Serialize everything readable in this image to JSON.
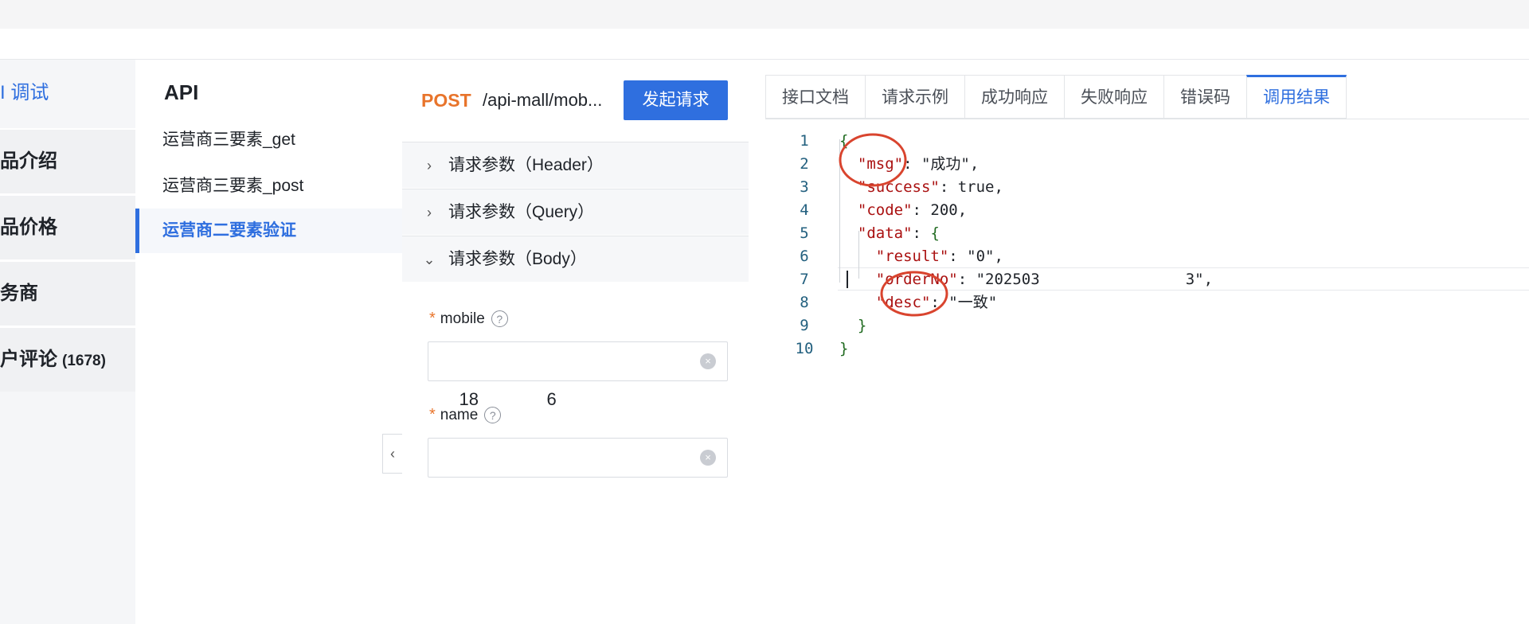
{
  "left_nav": {
    "items": [
      {
        "label": "I 调试",
        "active": true
      },
      {
        "label": "品介绍"
      },
      {
        "label": "品价格"
      },
      {
        "label": "务商"
      },
      {
        "label": "户评论",
        "count": "(1678)"
      }
    ]
  },
  "api_list": {
    "title": "API",
    "items": [
      {
        "label": "运营商三要素_get"
      },
      {
        "label": "运营商三要素_post"
      },
      {
        "label": "运营商二要素验证",
        "active": true
      }
    ]
  },
  "request": {
    "method": "POST",
    "path": "/api-mall/mob...",
    "send_label": "发起请求",
    "sections": [
      {
        "label": "请求参数（Header）",
        "chevron": "chevron-right-icon"
      },
      {
        "label": "请求参数（Query）",
        "chevron": "chevron-right-icon"
      },
      {
        "label": "请求参数（Body）",
        "chevron": "chevron-down-icon"
      }
    ],
    "fields": [
      {
        "name": "mobile",
        "required_mark": "*",
        "value": "18              6"
      },
      {
        "name": "name",
        "required_mark": "*",
        "value": ""
      }
    ]
  },
  "response": {
    "tabs": [
      {
        "label": "接口文档"
      },
      {
        "label": "请求示例"
      },
      {
        "label": "成功响应"
      },
      {
        "label": "失败响应"
      },
      {
        "label": "错误码"
      },
      {
        "label": "调用结果",
        "active": true
      }
    ],
    "code_lines": [
      {
        "n": "1",
        "text": "{"
      },
      {
        "n": "2",
        "text": "  \"msg\": \"成功\","
      },
      {
        "n": "3",
        "text": "  \"success\": true,"
      },
      {
        "n": "4",
        "text": "  \"code\": 200,"
      },
      {
        "n": "5",
        "text": "  \"data\": {"
      },
      {
        "n": "6",
        "text": "    \"result\": \"0\","
      },
      {
        "n": "7",
        "text": "    \"orderNo\": \"202503                3\","
      },
      {
        "n": "8",
        "text": "    \"desc\": \"一致\""
      },
      {
        "n": "9",
        "text": "  }"
      },
      {
        "n": "10",
        "text": "}"
      }
    ]
  },
  "colors": {
    "accent": "#2f6fdf",
    "method": "#e8742b",
    "annotation": "#d9442e"
  }
}
